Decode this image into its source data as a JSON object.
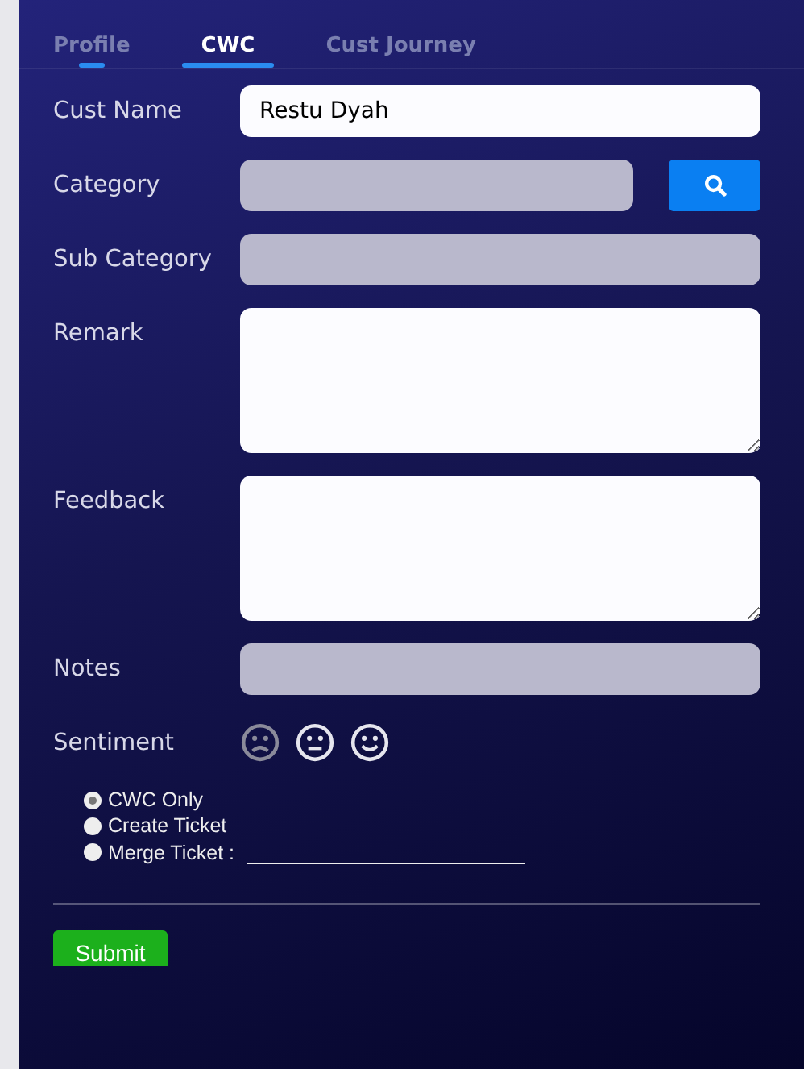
{
  "tabs": [
    {
      "label": "Profile",
      "selected": false,
      "hovered": true
    },
    {
      "label": "CWC",
      "selected": true,
      "hovered": false
    },
    {
      "label": "Cust Journey",
      "selected": false,
      "hovered": false
    }
  ],
  "fields": [
    {
      "label": "Cust Name",
      "kind": "input",
      "value": "Restu Dyah",
      "disabled": false
    },
    {
      "label": "Category",
      "kind": "search",
      "disabled": true
    },
    {
      "label": "Sub Category",
      "kind": "input",
      "disabled": true
    },
    {
      "label": "Remark",
      "kind": "textarea",
      "disabled": false
    },
    {
      "label": "Feedback",
      "kind": "textarea",
      "disabled": false
    },
    {
      "label": "Notes",
      "kind": "input",
      "disabled": true
    }
  ],
  "sentiment": {
    "label": "Sentiment",
    "faces": [
      {
        "kind": "sad",
        "dimmed": true
      },
      {
        "kind": "neutral",
        "dimmed": false
      },
      {
        "kind": "happy",
        "dimmed": false
      }
    ]
  },
  "options": [
    {
      "label": "CWC Only",
      "selected": true,
      "kind": "plain"
    },
    {
      "label": "Create Ticket",
      "selected": false,
      "kind": "plain"
    },
    {
      "label": "Merge Ticket :",
      "selected": false,
      "kind": "line"
    }
  ],
  "submit": "Submit"
}
